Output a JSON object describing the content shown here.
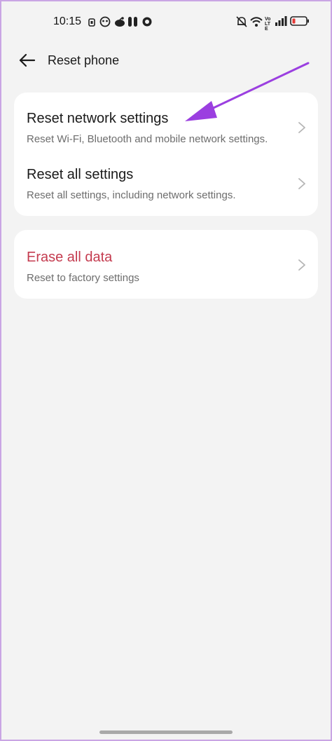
{
  "status_bar": {
    "time": "10:15",
    "left_icons": [
      "notification-small-icon",
      "face-icon",
      "reddit-icon",
      "app-icon",
      "circle-app-icon"
    ],
    "right_icons": [
      "muted-bell-icon",
      "wifi-icon",
      "volte-icon",
      "signal-icon",
      "battery-low-icon"
    ],
    "volte_label": "Vo LTE"
  },
  "header": {
    "title": "Reset phone"
  },
  "settings_group": [
    {
      "title": "Reset network settings",
      "subtitle": "Reset Wi-Fi, Bluetooth and mobile network settings."
    },
    {
      "title": "Reset all settings",
      "subtitle": "Reset all settings, including network settings."
    }
  ],
  "danger_group": {
    "title": "Erase all data",
    "subtitle": "Reset to factory settings"
  },
  "colors": {
    "background": "#f3f3f3",
    "card": "#ffffff",
    "danger_text": "#c43b4f",
    "annotation_arrow": "#9b3fe0",
    "frame_border": "#c9a5e4"
  }
}
